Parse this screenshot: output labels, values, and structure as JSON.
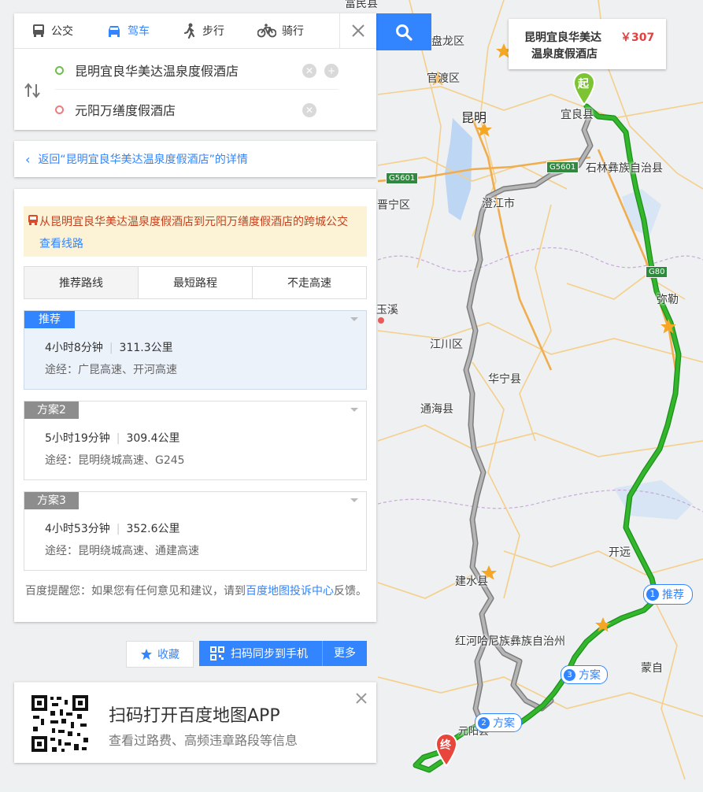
{
  "map": {
    "labels": {
      "fuminxian": "富民县",
      "panlongqu": "盘龙区",
      "guanduqu": "官渡区",
      "kunming": "昆明",
      "yiliangxian": "宜良县",
      "shilin": "石林彝族自治县",
      "jinningqu": "晋宁区",
      "chengjiang": "澄江市",
      "mile": "弥勒",
      "yuxi": "玉溪",
      "jiangchuanqu": "江川区",
      "huaning": "华宁县",
      "tonghai": "通海县",
      "kaiyuan": "开远",
      "jianshui": "建水县",
      "honghe": "红河哈尼族彝族自治州",
      "mengzi": "蒙自",
      "yuanyang": "元阳县"
    },
    "shields": {
      "g5601_a": "G5601",
      "g5601_b": "G5601",
      "g80": "G80"
    },
    "hotel_callout": {
      "name_line1": "昆明宜良华美达",
      "name_line2": "温泉度假酒店",
      "price": "￥307"
    },
    "pins": {
      "start": "起",
      "end": "终"
    },
    "route_tags": {
      "r1_num": "1",
      "r1_label": "推荐",
      "r2_num": "2",
      "r2_label": "方案",
      "r3_num": "3",
      "r3_label": "方案"
    },
    "colors": {
      "recommended_route": "#33b52c",
      "alt_route": "#9b9b9b",
      "accent": "#3385ff"
    }
  },
  "nav": {
    "modes": [
      {
        "label": "公交",
        "icon": "bus-icon"
      },
      {
        "label": "驾车",
        "icon": "car-icon"
      },
      {
        "label": "步行",
        "icon": "walk-icon"
      },
      {
        "label": "骑行",
        "icon": "bike-icon"
      }
    ],
    "active_mode": "驾车"
  },
  "search": {
    "origin": "昆明宜良华美达温泉度假酒店",
    "destination": "元阳万缮度假酒店"
  },
  "back_link": "返回“昆明宜良华美达温泉度假酒店”的详情",
  "bus_notice": {
    "text": "从昆明宜良华美达温泉度假酒店到元阳万缮度假酒店的跨城公交",
    "link": "查看线路"
  },
  "route_tabs": [
    "推荐路线",
    "最短路程",
    "不走高速"
  ],
  "routes": [
    {
      "badge": "推荐",
      "time": "4小时8分钟",
      "distance": "311.3公里",
      "via": "途经：广昆高速、开河高速"
    },
    {
      "badge": "方案2",
      "time": "5小时19分钟",
      "distance": "309.4公里",
      "via": "途经：昆明绕城高速、G245"
    },
    {
      "badge": "方案3",
      "time": "4小时53分钟",
      "distance": "352.6公里",
      "via": "途经：昆明绕城高速、通建高速"
    }
  ],
  "feedback": {
    "prefix": "百度提醒您：如果您有任何意见和建议，请到",
    "link": "百度地图投诉中心",
    "suffix": "反馈。"
  },
  "actions": {
    "favorite": "收藏",
    "sync": "扫码同步到手机",
    "more": "更多"
  },
  "app_promo": {
    "title": "扫码打开百度地图APP",
    "subtitle": "查看过路费、高频违章路段等信息"
  }
}
